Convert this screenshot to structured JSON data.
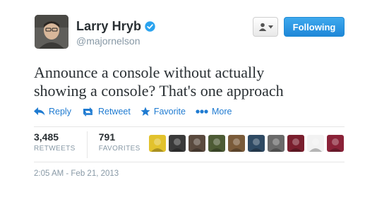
{
  "user": {
    "full_name": "Larry Hryb",
    "username": "@majornelson"
  },
  "follow_button": {
    "label": "Following"
  },
  "tweet": {
    "line1": "Announce a console without actually",
    "line2": "showing a console? That's one approach"
  },
  "actions": {
    "reply": "Reply",
    "retweet": "Retweet",
    "favorite": "Favorite",
    "more": "More"
  },
  "stats": {
    "retweets_count": "3,485",
    "retweets_label": "RETWEETS",
    "favorites_count": "791",
    "favorites_label": "FAVORITES"
  },
  "favoriters": [
    {
      "color": "#e2c22d"
    },
    {
      "color": "#3a3a3a"
    },
    {
      "color": "#5a4a3e"
    },
    {
      "color": "#4d5b35"
    },
    {
      "color": "#7a5b3a"
    },
    {
      "color": "#2f4a63"
    },
    {
      "color": "#6a6a6a"
    },
    {
      "color": "#7a1f2e"
    },
    {
      "color": "#f2f2f2"
    },
    {
      "color": "#8a2238"
    }
  ],
  "timestamp": "2:05 AM - Feb 21, 2013",
  "colors": {
    "link_blue": "#1f7bd1",
    "follow_blue": "#2b97e3",
    "verified_blue": "#2aa3ef"
  }
}
